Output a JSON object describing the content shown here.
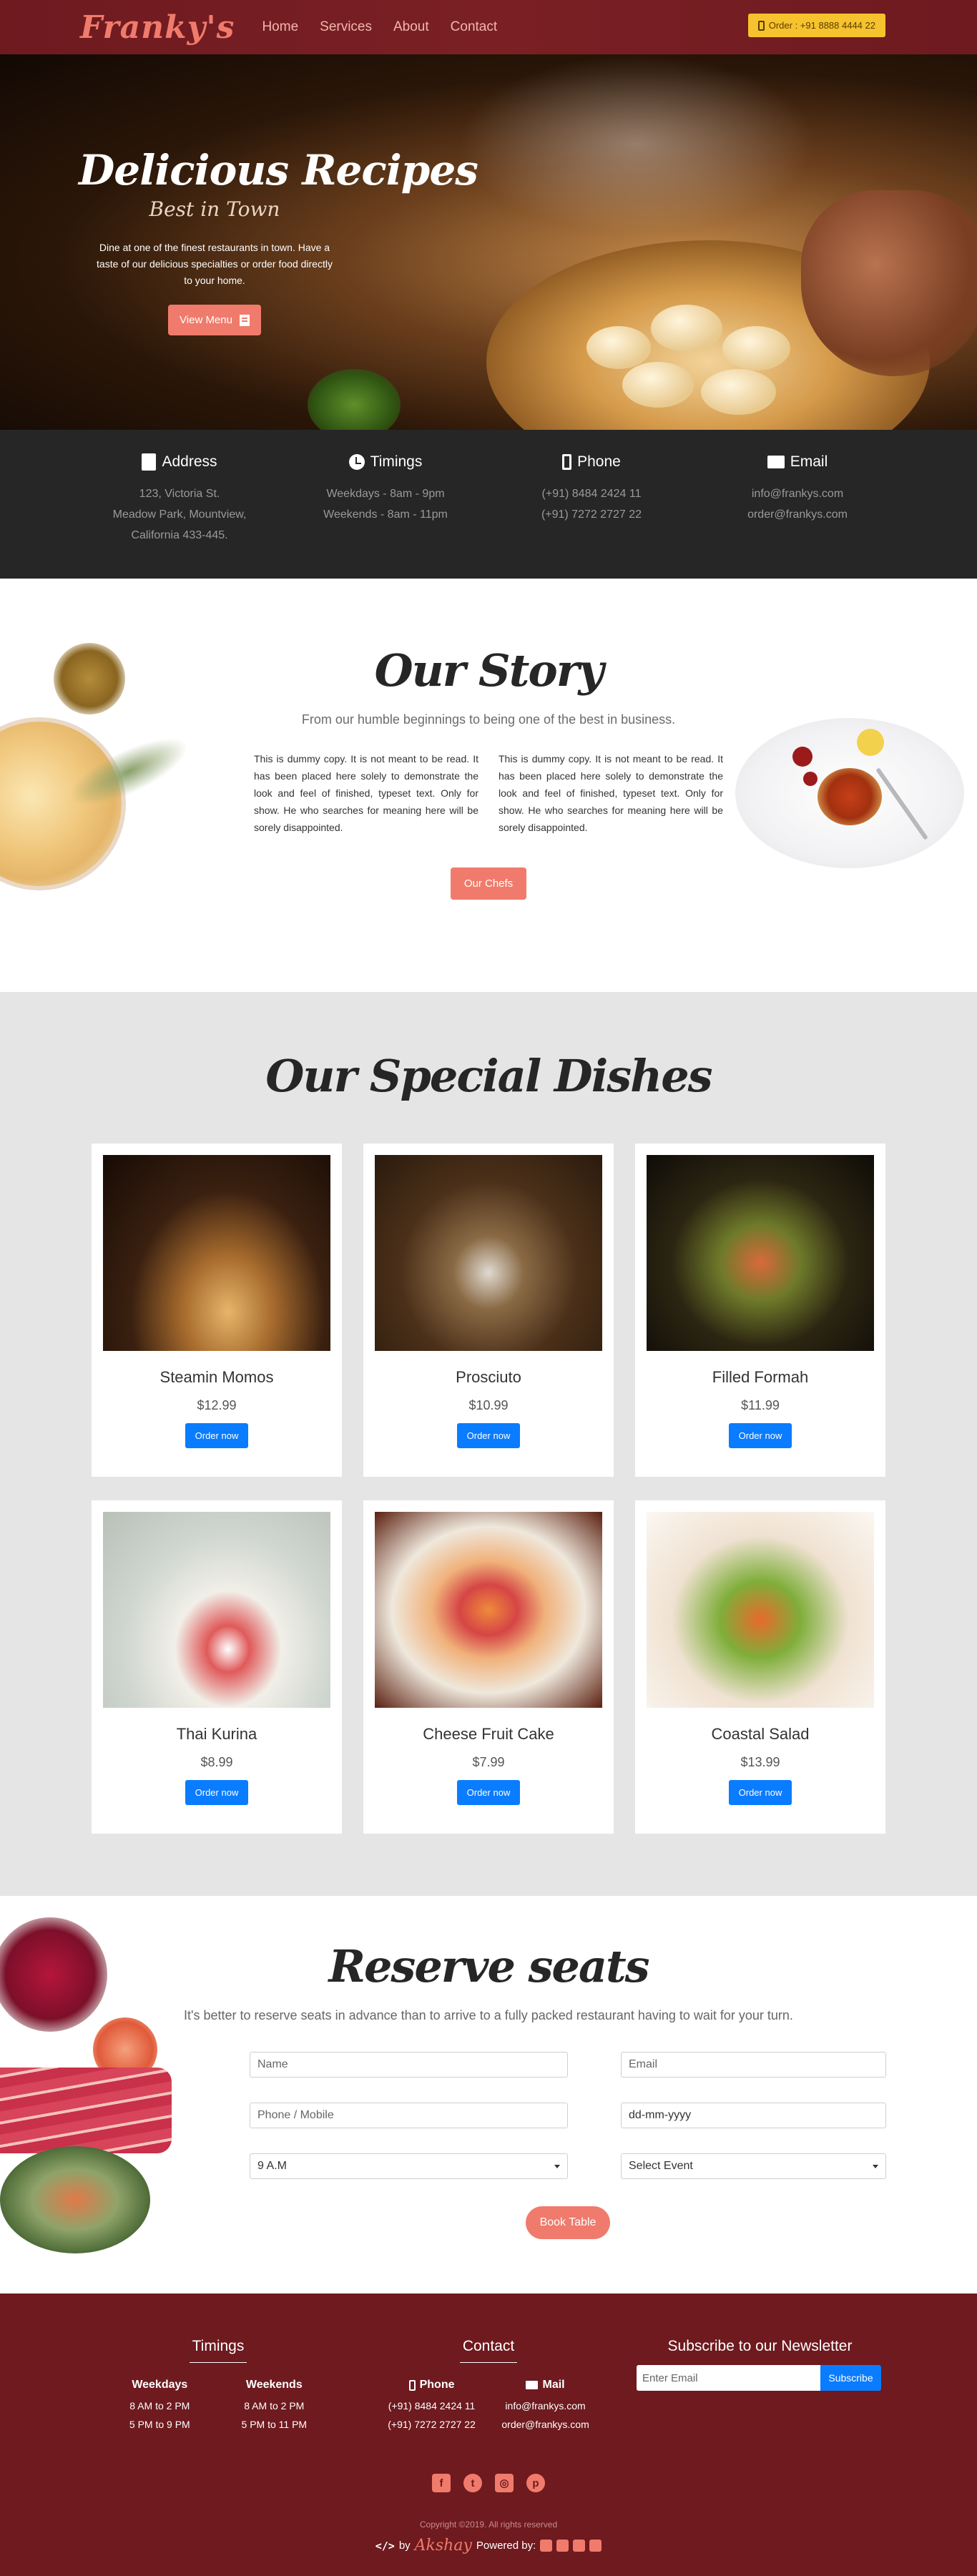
{
  "nav": {
    "brand": "Franky's",
    "links": [
      "Home",
      "Services",
      "About",
      "Contact"
    ],
    "order_label": "Order : +91 8888 4444 22"
  },
  "hero": {
    "title": "Delicious Recipes",
    "subtitle": "Best in Town",
    "text": "Dine at one of the finest restaurants in town. Have a taste of our delicious specialties or order food directly to your home.",
    "button": "View Menu"
  },
  "info": {
    "address": {
      "title": "Address",
      "lines": [
        "123, Victoria St.",
        "Meadow Park, Mountview,",
        "California 433-445."
      ]
    },
    "timings": {
      "title": "Timings",
      "lines": [
        "Weekdays - 8am - 9pm",
        "Weekends - 8am - 11pm"
      ]
    },
    "phone": {
      "title": "Phone",
      "lines": [
        "(+91) 8484 2424 11",
        "(+91) 7272 2727 22"
      ]
    },
    "email": {
      "title": "Email",
      "lines": [
        "info@frankys.com",
        "order@frankys.com"
      ]
    }
  },
  "story": {
    "title": "Our Story",
    "lead": "From our humble beginnings to being one of the best in business.",
    "col1": "This is dummy copy. It is not meant to be read. It has been placed here solely to demonstrate the look and feel of finished, typeset text. Only for show. He who searches for meaning here will be sorely disappointed.",
    "col2": "This is dummy copy. It is not meant to be read. It has been placed here solely to demonstrate the look and feel of finished, typeset text. Only for show. He who searches for meaning here will be sorely disappointed.",
    "button": "Our Chefs"
  },
  "dishes": {
    "title": "Our Special Dishes",
    "order_label": "Order now",
    "items": [
      {
        "name": "Steamin Momos",
        "price": "$12.99"
      },
      {
        "name": "Prosciuto",
        "price": "$10.99"
      },
      {
        "name": "Filled Formah",
        "price": "$11.99"
      },
      {
        "name": "Thai Kurina",
        "price": "$8.99"
      },
      {
        "name": "Cheese Fruit Cake",
        "price": "$7.99"
      },
      {
        "name": "Coastal Salad",
        "price": "$13.99"
      }
    ]
  },
  "reserve": {
    "title": "Reserve seats",
    "lead": "It's better to reserve seats in advance than to arrive to a fully packed restaurant having to wait for your turn.",
    "name_placeholder": "Name",
    "email_placeholder": "Email",
    "phone_placeholder": "Phone / Mobile",
    "date_placeholder": "dd-mm-yyyy",
    "time_value": "9 A.M",
    "event_value": "Select Event",
    "button": "Book Table"
  },
  "footer": {
    "timings_title": "Timings",
    "weekdays_title": "Weekdays",
    "weekdays_lines": [
      "8 AM to 2 PM",
      "5 PM to 9 PM"
    ],
    "weekends_title": "Weekends",
    "weekends_lines": [
      "8 AM to 2 PM",
      "5 PM to 11 PM"
    ],
    "contact_title": "Contact",
    "phone_title": "Phone",
    "phone_lines": [
      "(+91) 8484 2424 11",
      "(+91) 7272 2727 22"
    ],
    "mail_title": "Mail",
    "mail_lines": [
      "info@frankys.com",
      "order@frankys.com"
    ],
    "newsletter_title": "Subscribe to our Newsletter",
    "newsletter_placeholder": "Enter Email",
    "subscribe": "Subscribe",
    "copyright": "Copyright ©2019. All rights reserved",
    "by_label": "by",
    "signature": "Akshay",
    "powered_label": "Powered by:"
  },
  "colors": {
    "brand": "#f07b6c",
    "maroon": "#6e1a1f",
    "dark": "#262626",
    "button_blue": "#0a7cff",
    "order_yellow": "#f6c22d"
  }
}
